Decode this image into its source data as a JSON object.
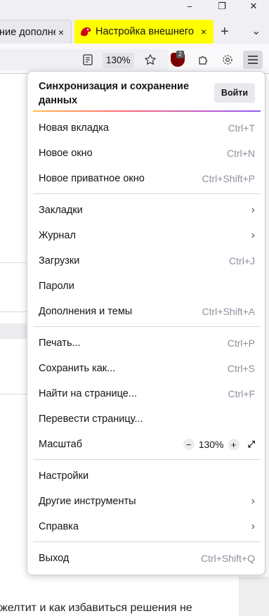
{
  "tabs": {
    "inactive_title": "ние дополне",
    "active_title": "Настройка внешнего",
    "close_glyph": "×",
    "new_tab_glyph": "+",
    "list_glyph": "⌄"
  },
  "window": {
    "minimize": "−",
    "restore": "❐",
    "close": "✕"
  },
  "toolbar": {
    "zoom": "130%",
    "ublock_count": "2"
  },
  "page": {
    "bottom_text": "желтит и как избавиться решения не"
  },
  "menu": {
    "sync_title": "Синхронизация и сохранение данных",
    "signin_label": "Войти",
    "groups": [
      [
        {
          "label": "Новая вкладка",
          "shortcut": "Ctrl+T"
        },
        {
          "label": "Новое окно",
          "shortcut": "Ctrl+N"
        },
        {
          "label": "Новое приватное окно",
          "shortcut": "Ctrl+Shift+P"
        }
      ],
      [
        {
          "label": "Закладки",
          "arrow": "›"
        },
        {
          "label": "Журнал",
          "arrow": "›"
        },
        {
          "label": "Загрузки",
          "shortcut": "Ctrl+J"
        },
        {
          "label": "Пароли"
        },
        {
          "label": "Дополнения и темы",
          "shortcut": "Ctrl+Shift+A"
        }
      ],
      [
        {
          "label": "Печать...",
          "shortcut": "Ctrl+P"
        },
        {
          "label": "Сохранить как...",
          "shortcut": "Ctrl+S"
        },
        {
          "label": "Найти на странице...",
          "shortcut": "Ctrl+F"
        },
        {
          "label": "Перевести страницу..."
        }
      ]
    ],
    "zoom_label": "Масштаб",
    "zoom_minus": "−",
    "zoom_value": "130%",
    "zoom_plus": "+",
    "zoom_fullscreen": "⤢",
    "group4": [
      {
        "label": "Настройки"
      },
      {
        "label": "Другие инструменты",
        "arrow": "›"
      },
      {
        "label": "Справка",
        "arrow": "›"
      }
    ],
    "exit": {
      "label": "Выход",
      "shortcut": "Ctrl+Shift+Q"
    }
  }
}
